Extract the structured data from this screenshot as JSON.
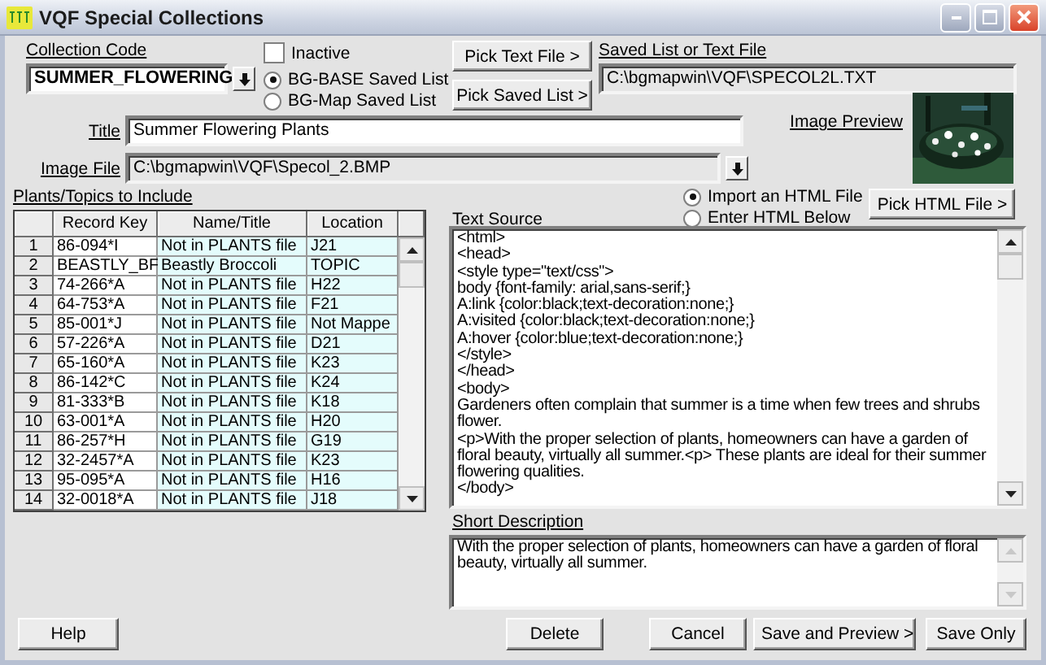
{
  "window": {
    "title": "VQF Special Collections"
  },
  "collection_code": {
    "label": "Collection Code",
    "value": "SUMMER_FLOWERING"
  },
  "inactive": {
    "label": "Inactive",
    "checked": false
  },
  "list_source": [
    {
      "label": "BG-BASE Saved List",
      "selected": true
    },
    {
      "label": "BG-Map Saved List",
      "selected": false
    }
  ],
  "pick_buttons": [
    "Pick Text File >",
    "Pick Saved List >"
  ],
  "saved_list": {
    "label": "Saved List or Text File",
    "value": "C:\\bgmapwin\\VQF\\SPECOL2L.TXT"
  },
  "title_field": {
    "label": "Title",
    "value": "Summer Flowering Plants"
  },
  "image_file": {
    "label": "Image File",
    "value": "C:\\bgmapwin\\VQF\\Specol_2.BMP"
  },
  "image_preview": {
    "label": "Image Preview",
    "kind": "picture"
  },
  "plants": {
    "label": "Plants/Topics to Include",
    "columns": [
      "Record Key",
      "Name/Title",
      "Location"
    ],
    "rows": [
      {
        "number": "1",
        "cells": [
          "86-094*I",
          "Not in PLANTS file",
          "J21"
        ]
      },
      {
        "number": "2",
        "cells": [
          "BEASTLY_BF",
          "Beastly Broccoli",
          "TOPIC"
        ]
      },
      {
        "number": "3",
        "cells": [
          "74-266*A",
          "Not in PLANTS file",
          "H22"
        ]
      },
      {
        "number": "4",
        "cells": [
          "64-753*A",
          "Not in PLANTS file",
          "F21"
        ]
      },
      {
        "number": "5",
        "cells": [
          "85-001*J",
          "Not in PLANTS file",
          "Not Mappe"
        ]
      },
      {
        "number": "6",
        "cells": [
          "57-226*A",
          "Not in PLANTS file",
          "D21"
        ]
      },
      {
        "number": "7",
        "cells": [
          "65-160*A",
          "Not in PLANTS file",
          "K23"
        ]
      },
      {
        "number": "8",
        "cells": [
          "86-142*C",
          "Not in PLANTS file",
          "K24"
        ]
      },
      {
        "number": "9",
        "cells": [
          "81-333*B",
          "Not in PLANTS file",
          "K18"
        ]
      },
      {
        "number": "10",
        "cells": [
          "63-001*A",
          "Not in PLANTS file",
          "H20"
        ]
      },
      {
        "number": "11",
        "cells": [
          "86-257*H",
          "Not in PLANTS file",
          "G19"
        ]
      },
      {
        "number": "12",
        "cells": [
          "32-2457*A",
          "Not in PLANTS file",
          "K23"
        ]
      },
      {
        "number": "13",
        "cells": [
          "95-095*A",
          "Not in PLANTS file",
          "H16"
        ]
      },
      {
        "number": "14",
        "cells": [
          "32-0018*A",
          "Not in PLANTS file",
          "J18"
        ]
      }
    ]
  },
  "html_source": [
    {
      "label": "Import an HTML File",
      "selected": true
    },
    {
      "label": "Enter HTML Below",
      "selected": false
    }
  ],
  "pick_html_button": "Pick HTML File >",
  "text_source": {
    "label": "Text Source",
    "lines": [
      "<html>",
      "<head>",
      "<style type=\"text/css\">",
      "body {font-family: arial,sans-serif;}",
      "A:link {color:black;text-decoration:none;}",
      "A:visited {color:black;text-decoration:none;}",
      "A:hover {color:blue;text-decoration:none;}",
      "</style>",
      "</head>",
      "<body>",
      "Gardeners often complain that summer is a time when few trees and shrubs flower.",
      "<p>With the proper selection of plants, homeowners can have a garden of floral beauty, virtually all summer.<p> These plants are ideal for their summer flowering qualities.",
      "</body>"
    ]
  },
  "short_description": {
    "label": "Short Description",
    "value": "With the proper selection of plants, homeowners can have a garden of floral beauty, virtually all summer."
  },
  "buttons": [
    "Help",
    "Delete",
    "Cancel",
    "Save and Preview >",
    "Save Only"
  ]
}
